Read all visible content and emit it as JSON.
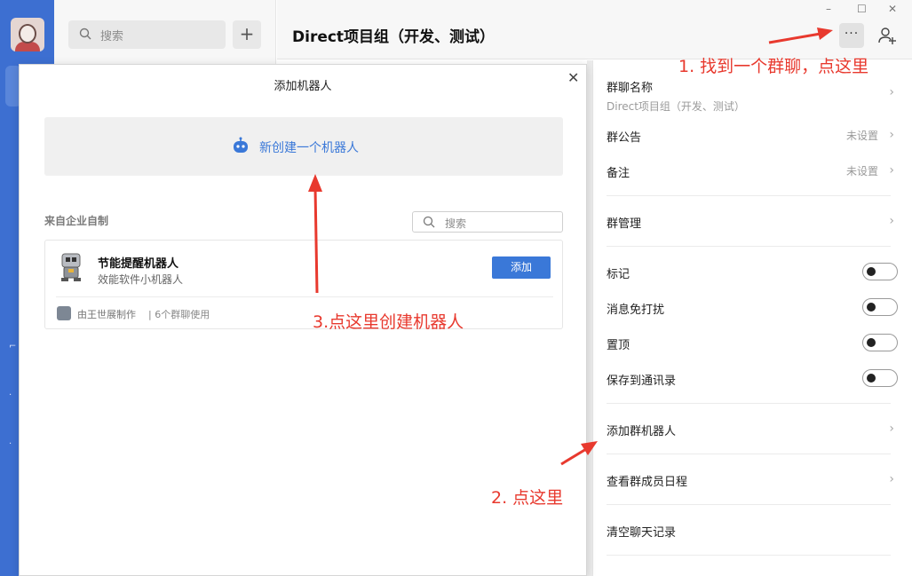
{
  "app": {
    "search_placeholder": "搜索",
    "plus_icon": "plus-icon"
  },
  "chat": {
    "title": "Direct项目组（开发、测试）",
    "more_icon": "more-icon",
    "add_member_icon": "add-member-icon",
    "window_controls": [
      "–",
      "☐",
      "✕"
    ]
  },
  "panel": {
    "group_name_label": "群聊名称",
    "group_name_value": "Direct项目组（开发、测试）",
    "announcement_label": "群公告",
    "announcement_value": "未设置",
    "remark_label": "备注",
    "remark_value": "未设置",
    "manage_label": "群管理",
    "mark_label": "标记",
    "mute_label": "消息免打扰",
    "pin_label": "置顶",
    "save_contacts_label": "保存到通讯录",
    "add_bot_label": "添加群机器人",
    "schedule_label": "查看群成员日程",
    "clear_label": "清空聊天记录",
    "chevron": "›",
    "toggles": {
      "mark": false,
      "mute": false,
      "pin": false,
      "save_contacts": false
    }
  },
  "modal": {
    "title": "添加机器人",
    "close": "✕",
    "create_label": "新创建一个机器人",
    "section_label": "来自企业自制",
    "search_placeholder": "搜索",
    "bot": {
      "name": "节能提醒机器人",
      "description": "效能软件小机器人",
      "add_label": "添加",
      "maker": "由王世展制作",
      "usage": "| 6个群聊使用"
    }
  },
  "annotations": {
    "step1": "1. 找到一个群聊，点这里",
    "step2": "2. 点这里",
    "step3": "3.点这里创建机器人",
    "color": "#e8392e"
  }
}
